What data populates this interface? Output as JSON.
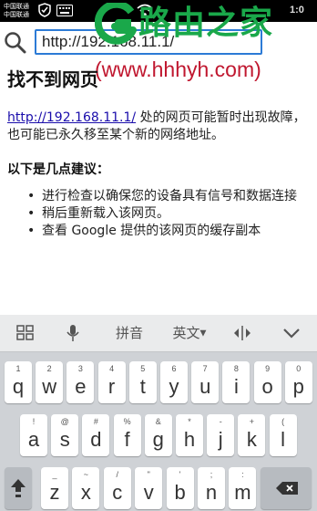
{
  "status_bar": {
    "carrier_1": "中国联通",
    "carrier_2": "中国联通",
    "right_text": "1:0"
  },
  "browser": {
    "url": "http://192.168.11.1/"
  },
  "watermark": {
    "title": "路由之家",
    "url": "(www.hhhyh.com)"
  },
  "page": {
    "heading": "找不到网页",
    "link": "http://192.168.11.1/",
    "message": " 处的网页可能暂时出现故障，也可能已永久移至某个新的网络地址。",
    "suggestions_title": "以下是几点建议：",
    "suggestions": [
      "进行检查以确保您的设备具有信号和数据连接",
      "稍后重新载入该网页。",
      "查看 Google 提供的该网页的缓存副本"
    ]
  },
  "keyboard": {
    "toolbar": {
      "pinyin_label": "拼音",
      "lang_label": "英文"
    },
    "rows": [
      [
        {
          "main": "q",
          "alt": "1"
        },
        {
          "main": "w",
          "alt": "2"
        },
        {
          "main": "e",
          "alt": "3"
        },
        {
          "main": "r",
          "alt": "4"
        },
        {
          "main": "t",
          "alt": "5"
        },
        {
          "main": "y",
          "alt": "6"
        },
        {
          "main": "u",
          "alt": "7"
        },
        {
          "main": "i",
          "alt": "8"
        },
        {
          "main": "o",
          "alt": "9"
        },
        {
          "main": "p",
          "alt": "0"
        }
      ],
      [
        {
          "main": "a",
          "alt": "!"
        },
        {
          "main": "s",
          "alt": "@"
        },
        {
          "main": "d",
          "alt": "#"
        },
        {
          "main": "f",
          "alt": "%"
        },
        {
          "main": "g",
          "alt": "&"
        },
        {
          "main": "h",
          "alt": "*"
        },
        {
          "main": "j",
          "alt": "-"
        },
        {
          "main": "k",
          "alt": "+"
        },
        {
          "main": "l",
          "alt": "("
        }
      ],
      [
        {
          "main": "z",
          "alt": "_"
        },
        {
          "main": "x",
          "alt": "~"
        },
        {
          "main": "c",
          "alt": "/"
        },
        {
          "main": "v",
          "alt": "\""
        },
        {
          "main": "b",
          "alt": "'"
        },
        {
          "main": "n",
          "alt": ";"
        },
        {
          "main": "m",
          "alt": ":"
        }
      ]
    ]
  },
  "colors": {
    "url_border": "#2c7bd6",
    "watermark_green": "#1aa84a",
    "watermark_red": "#c0172f",
    "link": "#1a0dab"
  }
}
